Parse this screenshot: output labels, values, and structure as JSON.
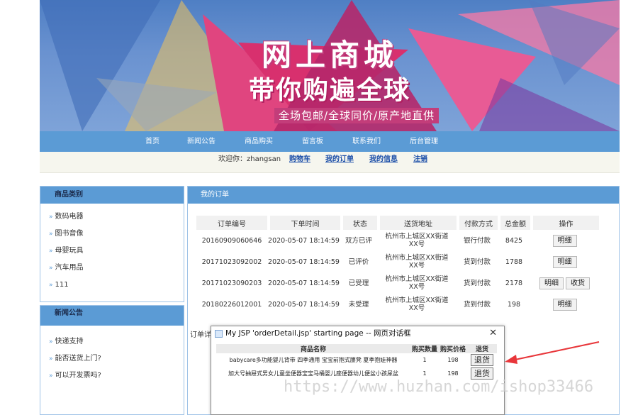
{
  "banner": {
    "title": "网上商城",
    "subtitle": "带你购遍全球",
    "tagline": "全场包邮/全球同价/原产地直供"
  },
  "nav": {
    "items": [
      "首页",
      "新闻公告",
      "商品购买",
      "留言板",
      "联系我们",
      "后台管理"
    ]
  },
  "welcome": {
    "greeting": "欢迎你：zhangsan",
    "links": [
      "购物车",
      "我的订单",
      "我的信息",
      "注销"
    ]
  },
  "sidebar": {
    "category_title": "商品类别",
    "categories": [
      "数码电器",
      "图书音像",
      "母婴玩具",
      "汽车用品",
      "111"
    ],
    "news_title": "新闻公告",
    "news": [
      "快递支持",
      "能否送货上门?",
      "可以开发票吗?"
    ],
    "arrow": "»"
  },
  "orders": {
    "title": "我的订单",
    "headers": [
      "订单编号",
      "下单时间",
      "状态",
      "送货地址",
      "付款方式",
      "总金额",
      "操作"
    ],
    "rows": [
      {
        "id": "20160909060646",
        "time": "2020-05-07 18:14:59",
        "status": "双方已评",
        "addr1": "杭州市上城区XX街道",
        "addr2": "XX号",
        "pay": "银行付款",
        "total": "8425",
        "actions": [
          "明细"
        ]
      },
      {
        "id": "20171023092002",
        "time": "2020-05-07 18:14:59",
        "status": "已评价",
        "addr1": "杭州市上城区XX街道",
        "addr2": "XX号",
        "pay": "货到付款",
        "total": "1788",
        "actions": [
          "明细"
        ]
      },
      {
        "id": "20171023090203",
        "time": "2020-05-07 18:14:59",
        "status": "已受理",
        "addr1": "杭州市上城区XX街道",
        "addr2": "XX号",
        "pay": "货到付款",
        "total": "2178",
        "actions": [
          "明细",
          "收货"
        ]
      },
      {
        "id": "20180226012001",
        "time": "2020-05-07 18:14:59",
        "status": "未受理",
        "addr1": "杭州市上城区XX街道",
        "addr2": "XX号",
        "pay": "货到付款",
        "total": "198",
        "actions": [
          "明细"
        ]
      }
    ],
    "cut_label": "订单详"
  },
  "dialog": {
    "title": "My JSP 'orderDetail.jsp' starting page -- 网页对话框",
    "close": "✕",
    "headers": [
      "商品名称",
      "购买数量",
      "购买价格",
      "退货"
    ],
    "rows": [
      {
        "name": "babycare多功能婴儿背带 四季通用 宝宝前抱式腰凳 夏季抱娃神器",
        "qty": "1",
        "price": "198",
        "action": "退货"
      },
      {
        "name": "加大号抽屉式男女儿童坐便器宝宝马桶婴儿座便器幼儿便盆小孩尿盆",
        "qty": "1",
        "price": "198",
        "action": "退货"
      }
    ]
  },
  "watermark": "https://www.huzhan.com/ishop33466",
  "colors": {
    "nav": "#5b9bd5",
    "link": "#1b4ea8",
    "annotation": "#e8363a"
  }
}
